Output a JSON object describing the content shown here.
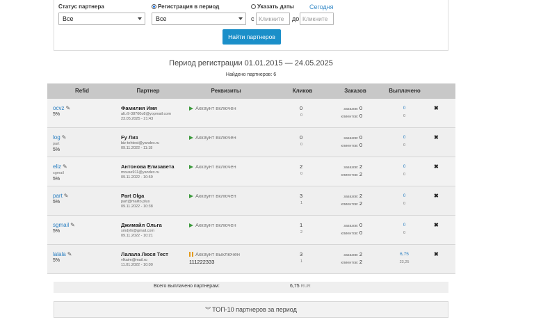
{
  "filters": {
    "status_label": "Статус партнера",
    "status_value": "Все",
    "reg_period_label": "Регистрация в период",
    "reg_period_value": "Все",
    "specify_dates_label": "Указать даты",
    "today_link": "Сегодня",
    "from_label": "с",
    "to_label": "до",
    "date_from_placeholder": "Кликните",
    "date_to_placeholder": "Кликните",
    "find_button": "Найти партнеров"
  },
  "period_title": "Период регистрации 01.01.2015 — 24.05.2025",
  "found_text": "Найдено партнеров: 6",
  "table": {
    "headers": {
      "refid": "Refid",
      "partner": "Партнер",
      "requisites": "Реквизиты",
      "clicks": "Кликов",
      "orders": "Заказов",
      "paid": "Выплачено"
    },
    "orders_label": "заказов:",
    "clients_label": "клиентов:",
    "rows": [
      {
        "refid": "ocvz",
        "refid_sub": "",
        "percent": "5%",
        "name": "Фамилия Имя",
        "email": "alt.r9-38760o8@yopmail.com",
        "date": "23.05.2025 - 21:43",
        "status": "Аккаунт включен",
        "status_type": "on",
        "requisites": "",
        "clicks": "0",
        "clicks_sub": "0",
        "orders": "0",
        "clients": "0",
        "paid": "0",
        "paid_sub": "0"
      },
      {
        "refid": "log",
        "refid_sub": "part",
        "percent": "5%",
        "name": "Fy Лиз",
        "email": "biz-tehtest@yandex.ru",
        "date": "09.11.2022 - 11:18",
        "status": "Аккаунт включен",
        "status_type": "on",
        "requisites": "",
        "clicks": "0",
        "clicks_sub": "0",
        "orders": "0",
        "clients": "0",
        "paid": "0",
        "paid_sub": "0"
      },
      {
        "refid": "eliz",
        "refid_sub": "sgmail",
        "percent": "5%",
        "name": "Антонова Елизавета",
        "email": "mouse911@yandex.ru",
        "date": "09.11.2022 - 10:59",
        "status": "Аккаунт включен",
        "status_type": "on",
        "requisites": "",
        "clicks": "2",
        "clicks_sub": "0",
        "orders": "2",
        "clients": "2",
        "paid": "0",
        "paid_sub": "0"
      },
      {
        "refid": "part",
        "refid_sub": "",
        "percent": "5%",
        "name": "Part Olga",
        "email": "part@mailto.plus",
        "date": "09.11.2022 - 10:38",
        "status": "Аккаунт включен",
        "status_type": "on",
        "requisites": "",
        "clicks": "3",
        "clicks_sub": "1",
        "orders": "2",
        "clients": "2",
        "paid": "0",
        "paid_sub": "0"
      },
      {
        "refid": "sgmail",
        "refid_sub": "",
        "percent": "5%",
        "name": "Джимайл Ольга",
        "email": "smdyfx@gmail.com",
        "date": "09.11.2022 - 10:21",
        "status": "Аккаунт включен",
        "status_type": "on",
        "requisites": "",
        "clicks": "1",
        "clicks_sub": "2",
        "orders": "0",
        "clients": "0",
        "paid": "0",
        "paid_sub": "0"
      },
      {
        "refid": "lalala",
        "refid_sub": "",
        "percent": "5%",
        "name": "Лалала Люся Тест",
        "email": "vlkaim@mail.ru",
        "date": "11.01.2022 - 10:00",
        "status": "Аккаунт выключен",
        "status_type": "off",
        "requisites": "111222333",
        "clicks": "3",
        "clicks_sub": "1",
        "orders": "2",
        "clients": "2",
        "paid": "6,75",
        "paid_sub": "23,25"
      }
    ]
  },
  "summary": {
    "label": "Всего выплачено партнерам:",
    "value": "6,75",
    "currency": "RUR"
  },
  "top10": {
    "label": "ТОП-10 партнеров за период"
  },
  "icons": {
    "edit": "pencil-square",
    "delete": "cross",
    "enabled": "green-play",
    "disabled": "orange-pause",
    "expand": "double-chevron-down"
  },
  "colors": {
    "accent": "#1b8fc9",
    "link": "#2a7fc1",
    "enabled": "#3c9a3c",
    "disabled": "#e39a1a"
  }
}
